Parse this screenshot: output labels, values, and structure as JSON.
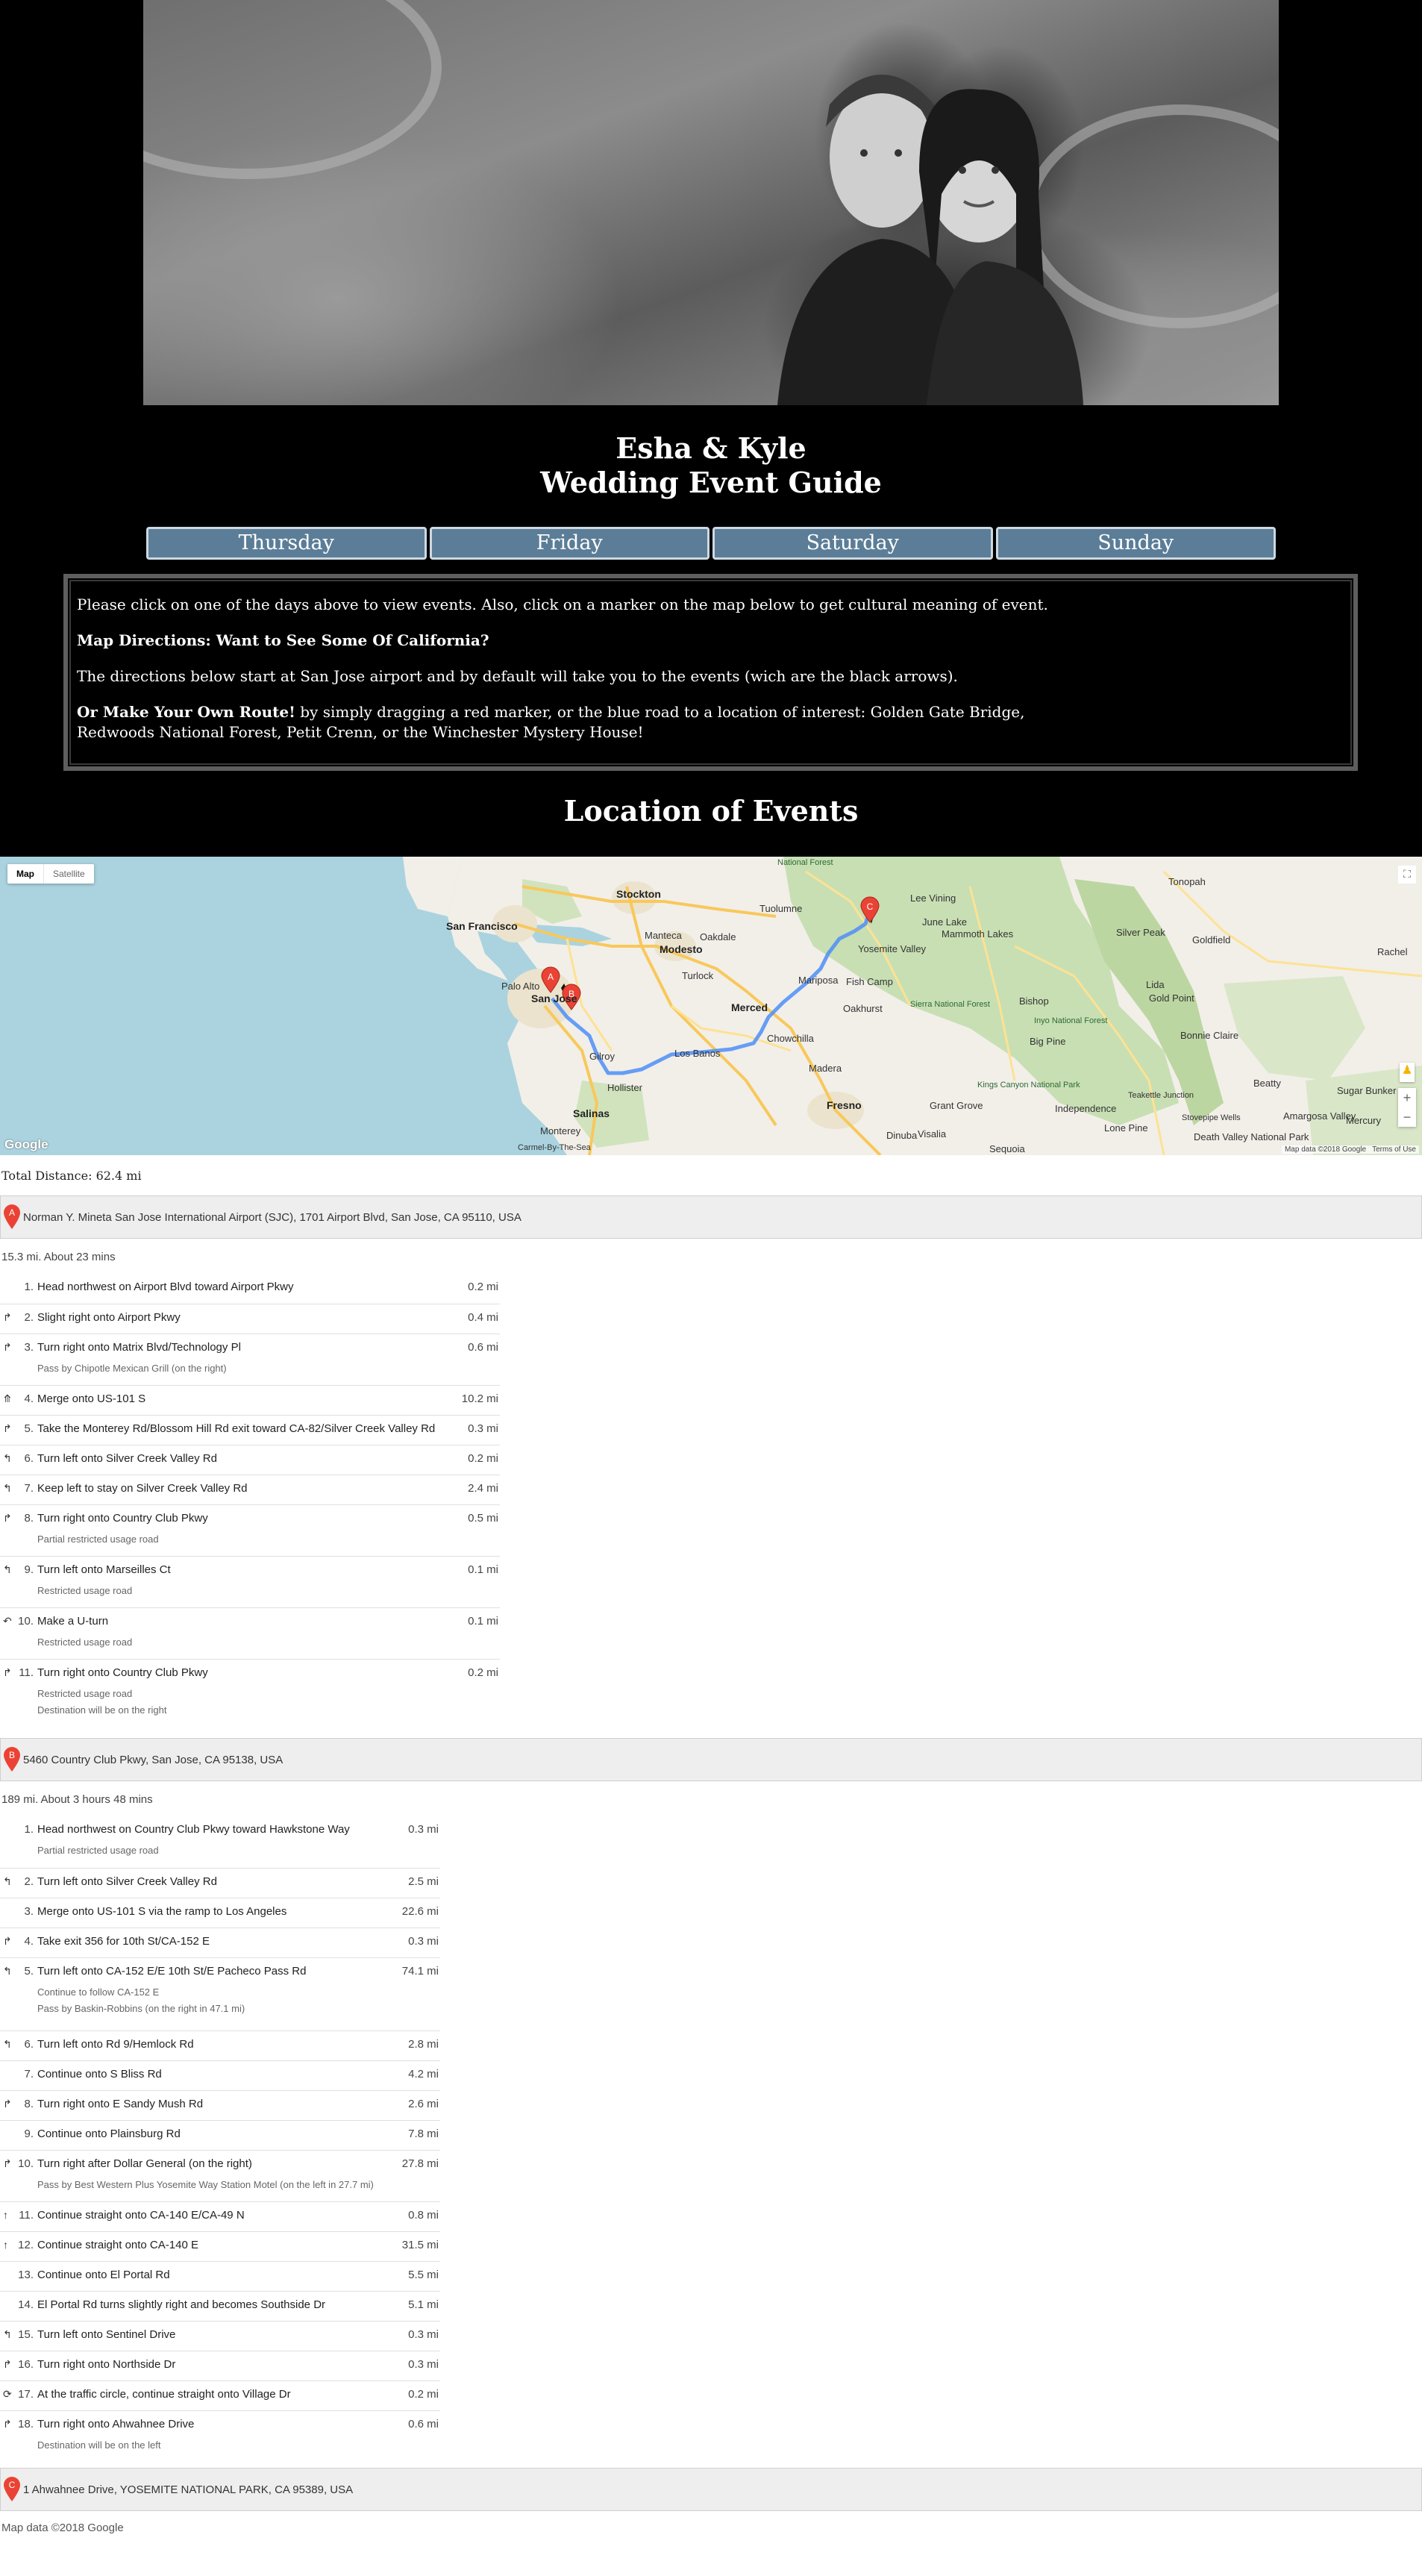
{
  "header": {
    "title_line1": "Esha & Kyle",
    "title_line2": "Wedding Event Guide",
    "tabs": [
      {
        "label": "Thursday"
      },
      {
        "label": "Friday"
      },
      {
        "label": "Saturday"
      },
      {
        "label": "Sunday"
      }
    ]
  },
  "info": {
    "intro": "Please click on one of the days above to view events. Also, click on a marker on the map below to get cultural meaning of event.",
    "directions_heading": "Map Directions: Want to See Some Of California?",
    "directions_text": "The directions below start at San Jose airport and by default will take you to the events (wich are the black arrows).",
    "own_route_bold": "Or Make Your Own Route!",
    "own_route_text": "by simply dragging a red marker, or the blue road to a location of interest: Golden Gate Bridge, Redwoods National Forest, Petit Crenn, or the Winchester Mystery House!"
  },
  "locations_title": "Location of Events",
  "map": {
    "type_map": "Map",
    "type_satellite": "Satellite",
    "attribution": "Map data ©2018 Google",
    "terms": "Terms of Use",
    "logo": "Google",
    "markers": [
      "A",
      "B",
      "C"
    ],
    "cities": [
      {
        "name": "San Francisco",
        "big": true
      },
      {
        "name": "Stockton"
      },
      {
        "name": "Modesto"
      },
      {
        "name": "Merced"
      },
      {
        "name": "Fresno"
      },
      {
        "name": "Salinas"
      },
      {
        "name": "Monterey"
      },
      {
        "name": "Gilroy"
      },
      {
        "name": "Hollister"
      },
      {
        "name": "Madera"
      },
      {
        "name": "Turlock"
      },
      {
        "name": "Oakdale"
      },
      {
        "name": "Manteca"
      },
      {
        "name": "Tuolumne"
      },
      {
        "name": "Mariposa"
      },
      {
        "name": "Los Banos"
      },
      {
        "name": "Chowchilla"
      },
      {
        "name": "Fish Camp"
      },
      {
        "name": "Oakhurst"
      },
      {
        "name": "Palo Alto"
      },
      {
        "name": "San Jose"
      },
      {
        "name": "Visalia"
      },
      {
        "name": "Sequoia"
      },
      {
        "name": "Dinuba"
      },
      {
        "name": "Bishop"
      },
      {
        "name": "Big Pine"
      },
      {
        "name": "Mammoth Lakes"
      },
      {
        "name": "June Lake"
      },
      {
        "name": "Lee Vining"
      },
      {
        "name": "Tonopah"
      },
      {
        "name": "Goldfield"
      },
      {
        "name": "Silver Peak"
      },
      {
        "name": "Lida"
      },
      {
        "name": "Gold Point"
      },
      {
        "name": "Bonnie Claire"
      },
      {
        "name": "Beatty"
      },
      {
        "name": "Rachel"
      },
      {
        "name": "Sugar Bunker"
      },
      {
        "name": "Amargosa Valley"
      },
      {
        "name": "Mercury"
      },
      {
        "name": "Death Valley National Park"
      },
      {
        "name": "Independence"
      },
      {
        "name": "Lone Pine"
      },
      {
        "name": "Sierra National Forest",
        "green": true
      },
      {
        "name": "Inyo National Forest",
        "green": true
      },
      {
        "name": "Kings Canyon National Park",
        "green": true
      },
      {
        "name": "National Forest",
        "green": true
      },
      {
        "name": "Yosemite Valley"
      },
      {
        "name": "Grant Grove"
      },
      {
        "name": "Carmel-By-The-Sea"
      },
      {
        "name": "Teakettle Junction"
      },
      {
        "name": "Stovepipe Wells"
      }
    ]
  },
  "directions": {
    "total_distance": "Total Distance: 62.4 mi",
    "leg1": {
      "start_label": "A",
      "start": "Norman Y. Mineta San Jose International Airport (SJC), 1701 Airport Blvd, San Jose, CA 95110, USA",
      "summary": "15.3 mi. About 23 mins",
      "steps": [
        {
          "num": "1.",
          "icon": "",
          "text": "Head northwest on Airport Blvd toward Airport Pkwy",
          "note": "",
          "dist": "0.2 mi"
        },
        {
          "num": "2.",
          "icon": "↱",
          "text": "Slight right onto Airport Pkwy",
          "note": "",
          "dist": "0.4 mi"
        },
        {
          "num": "3.",
          "icon": "↱",
          "text": "Turn right onto Matrix Blvd/Technology Pl",
          "note": "Pass by Chipotle Mexican Grill (on the right)",
          "dist": "0.6 mi"
        },
        {
          "num": "4.",
          "icon": "⤊",
          "text": "Merge onto US-101 S",
          "note": "",
          "dist": "10.2 mi"
        },
        {
          "num": "5.",
          "icon": "↱",
          "text": "Take the Monterey Rd/Blossom Hill Rd exit toward CA-82/Silver Creek Valley Rd",
          "note": "",
          "dist": "0.3 mi"
        },
        {
          "num": "6.",
          "icon": "↰",
          "text": "Turn left onto Silver Creek Valley Rd",
          "note": "",
          "dist": "0.2 mi"
        },
        {
          "num": "7.",
          "icon": "↰",
          "text": "Keep left to stay on Silver Creek Valley Rd",
          "note": "",
          "dist": "2.4 mi"
        },
        {
          "num": "8.",
          "icon": "↱",
          "text": "Turn right onto Country Club Pkwy",
          "note": "Partial restricted usage road",
          "dist": "0.5 mi"
        },
        {
          "num": "9.",
          "icon": "↰",
          "text": "Turn left onto Marseilles Ct",
          "note": "Restricted usage road",
          "dist": "0.1 mi"
        },
        {
          "num": "10.",
          "icon": "↶",
          "text": "Make a U-turn",
          "note": "Restricted usage road",
          "dist": "0.1 mi"
        },
        {
          "num": "11.",
          "icon": "↱",
          "text": "Turn right onto Country Club Pkwy",
          "note": "Restricted usage road\nDestination will be on the right",
          "dist": "0.2 mi"
        }
      ]
    },
    "leg2": {
      "start_label": "B",
      "start": "5460 Country Club Pkwy, San Jose, CA 95138, USA",
      "summary": "189 mi. About 3 hours 48 mins",
      "steps": [
        {
          "num": "1.",
          "icon": "",
          "text": "Head northwest on Country Club Pkwy toward Hawkstone Way",
          "note": "Partial restricted usage road",
          "dist": "0.3 mi"
        },
        {
          "num": "2.",
          "icon": "↰",
          "text": "Turn left onto Silver Creek Valley Rd",
          "note": "",
          "dist": "2.5 mi"
        },
        {
          "num": "3.",
          "icon": "",
          "text": "Merge onto US-101 S via the ramp to Los Angeles",
          "note": "",
          "dist": "22.6 mi"
        },
        {
          "num": "4.",
          "icon": "↱",
          "text": "Take exit 356 for 10th St/CA-152 E",
          "note": "",
          "dist": "0.3 mi"
        },
        {
          "num": "5.",
          "icon": "↰",
          "text": "Turn left onto CA-152 E/E 10th St/E Pacheco Pass Rd",
          "note": "Continue to follow CA-152 E\nPass by Baskin-Robbins (on the right in 47.1 mi)",
          "dist": "74.1 mi"
        },
        {
          "num": "6.",
          "icon": "↰",
          "text": "Turn left onto Rd 9/Hemlock Rd",
          "note": "",
          "dist": "2.8 mi"
        },
        {
          "num": "7.",
          "icon": "",
          "text": "Continue onto S Bliss Rd",
          "note": "",
          "dist": "4.2 mi"
        },
        {
          "num": "8.",
          "icon": "↱",
          "text": "Turn right onto E Sandy Mush Rd",
          "note": "",
          "dist": "2.6 mi"
        },
        {
          "num": "9.",
          "icon": "",
          "text": "Continue onto Plainsburg Rd",
          "note": "",
          "dist": "7.8 mi"
        },
        {
          "num": "10.",
          "icon": "↱",
          "text": "Turn right after Dollar General (on the right)",
          "note": "Pass by Best Western Plus Yosemite Way Station Motel (on the left in 27.7 mi)",
          "dist": "27.8 mi"
        },
        {
          "num": "11.",
          "icon": "↑",
          "text": "Continue straight onto CA-140 E/CA-49 N",
          "note": "",
          "dist": "0.8 mi"
        },
        {
          "num": "12.",
          "icon": "↑",
          "text": "Continue straight onto CA-140 E",
          "note": "",
          "dist": "31.5 mi"
        },
        {
          "num": "13.",
          "icon": "",
          "text": "Continue onto El Portal Rd",
          "note": "",
          "dist": "5.5 mi"
        },
        {
          "num": "14.",
          "icon": "",
          "text": "El Portal Rd turns slightly right and becomes Southside Dr",
          "note": "",
          "dist": "5.1 mi"
        },
        {
          "num": "15.",
          "icon": "↰",
          "text": "Turn left onto Sentinel Drive",
          "note": "",
          "dist": "0.3 mi"
        },
        {
          "num": "16.",
          "icon": "↱",
          "text": "Turn right onto Northside Dr",
          "note": "",
          "dist": "0.3 mi"
        },
        {
          "num": "17.",
          "icon": "⟳",
          "text": "At the traffic circle, continue straight onto Village Dr",
          "note": "",
          "dist": "0.2 mi"
        },
        {
          "num": "18.",
          "icon": "↱",
          "text": "Turn right onto Ahwahnee Drive",
          "note": "Destination will be on the left",
          "dist": "0.6 mi"
        }
      ]
    },
    "end": {
      "label": "C",
      "address": "1 Ahwahnee Drive, YOSEMITE NATIONAL PARK, CA 95389, USA"
    },
    "footer_attribution": "Map data ©2018 Google"
  }
}
